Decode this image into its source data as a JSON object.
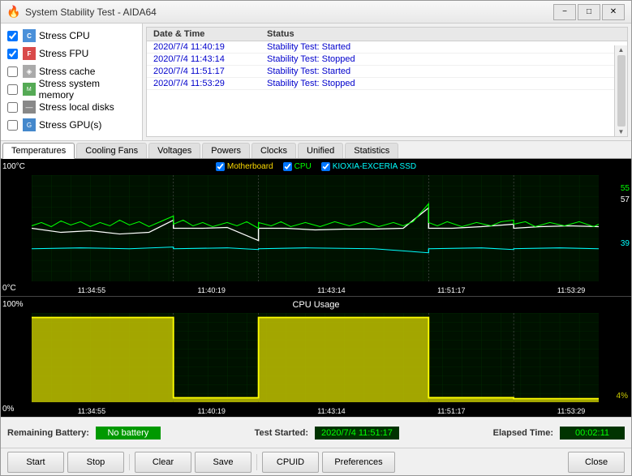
{
  "window": {
    "title": "System Stability Test - AIDA64",
    "minimize_label": "−",
    "maximize_label": "□",
    "close_label": "✕"
  },
  "checkboxes": [
    {
      "id": "stress_cpu",
      "label": "Stress CPU",
      "checked": true,
      "icon": "CPU"
    },
    {
      "id": "stress_fpu",
      "label": "Stress FPU",
      "checked": true,
      "icon": "FPU"
    },
    {
      "id": "stress_cache",
      "label": "Stress cache",
      "checked": false,
      "icon": "◈"
    },
    {
      "id": "stress_mem",
      "label": "Stress system memory",
      "checked": false,
      "icon": "M"
    },
    {
      "id": "stress_disk",
      "label": "Stress local disks",
      "checked": false,
      "icon": "—"
    },
    {
      "id": "stress_gpu",
      "label": "Stress GPU(s)",
      "checked": false,
      "icon": "G"
    }
  ],
  "log": {
    "headers": [
      "Date & Time",
      "Status"
    ],
    "rows": [
      {
        "time": "2020/7/4 11:40:19",
        "status": "Stability Test: Started"
      },
      {
        "time": "2020/7/4 11:43:14",
        "status": "Stability Test: Stopped"
      },
      {
        "time": "2020/7/4 11:51:17",
        "status": "Stability Test: Started"
      },
      {
        "time": "2020/7/4 11:53:29",
        "status": "Stability Test: Stopped"
      }
    ]
  },
  "tabs": [
    {
      "label": "Temperatures",
      "active": true
    },
    {
      "label": "Cooling Fans",
      "active": false
    },
    {
      "label": "Voltages",
      "active": false
    },
    {
      "label": "Powers",
      "active": false
    },
    {
      "label": "Clocks",
      "active": false
    },
    {
      "label": "Unified",
      "active": false
    },
    {
      "label": "Statistics",
      "active": false
    }
  ],
  "temp_chart": {
    "title": "",
    "legend": [
      {
        "label": "Motherboard",
        "color": "#ffffff",
        "checked": true
      },
      {
        "label": "CPU",
        "color": "#00ff00",
        "checked": true
      },
      {
        "label": "KIOXIA-EXCERIA SSD",
        "color": "#00ffff",
        "checked": true
      }
    ],
    "y_top": "100°C",
    "y_bottom": "0°C",
    "x_labels": [
      "11:34:55",
      "11:40:19",
      "11:43:14",
      "11:51:17",
      "11:53:29"
    ],
    "values_right": [
      "55",
      "57",
      "39"
    ]
  },
  "cpu_chart": {
    "title": "CPU Usage",
    "y_top": "100%",
    "y_bottom": "0%",
    "x_labels": [
      "11:34:55",
      "11:40:19",
      "11:43:14",
      "11:51:17",
      "11:53:29"
    ],
    "value_right": "4%"
  },
  "status_bar": {
    "battery_label": "Remaining Battery:",
    "battery_value": "No battery",
    "test_started_label": "Test Started:",
    "test_started_value": "2020/7/4 11:51:17",
    "elapsed_label": "Elapsed Time:",
    "elapsed_value": "00:02:11"
  },
  "buttons": {
    "start": "Start",
    "stop": "Stop",
    "clear": "Clear",
    "save": "Save",
    "cpuid": "CPUID",
    "preferences": "Preferences",
    "close": "Close"
  }
}
